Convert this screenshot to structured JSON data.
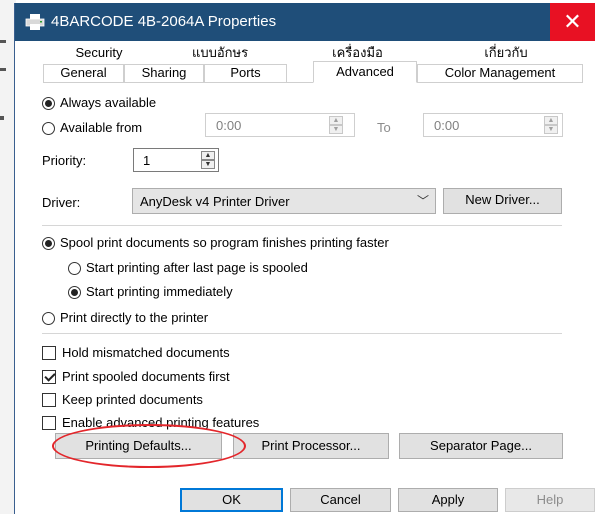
{
  "window": {
    "title": "4BARCODE 4B-2064A Properties",
    "close_glyph": "✕",
    "icon": "printer-icon"
  },
  "tabs": {
    "row1": [
      "Security",
      "แบบอักษร",
      "เครื่องมือ",
      "เกี่ยวกับ"
    ],
    "row2": [
      "General",
      "Sharing",
      "Ports",
      "Advanced",
      "Color Management"
    ],
    "active": "Advanced"
  },
  "availability": {
    "always_label": "Always available",
    "from_label": "Available from",
    "from_time": "0:00",
    "to_label": "To",
    "to_time": "0:00",
    "selected": "always"
  },
  "priority": {
    "label": "Priority:",
    "value": "1"
  },
  "driver": {
    "label": "Driver:",
    "value": "AnyDesk v4 Printer Driver",
    "new_driver_button": "New Driver..."
  },
  "spooling": {
    "spool_label": "Spool print documents so program finishes printing faster",
    "after_last_page_label": "Start printing after last page is spooled",
    "immediately_label": "Start printing immediately",
    "direct_label": "Print directly to the printer",
    "selected_mode": "spool",
    "selected_spool_option": "immediately"
  },
  "options": {
    "hold_mismatched": {
      "label": "Hold mismatched documents",
      "checked": false
    },
    "print_spooled_first": {
      "label": "Print spooled documents first",
      "checked": true
    },
    "keep_printed": {
      "label": "Keep printed documents",
      "checked": false
    },
    "enable_advanced": {
      "label": "Enable advanced printing features",
      "checked": false
    }
  },
  "buttons": {
    "printing_defaults": "Printing Defaults...",
    "print_processor": "Print Processor...",
    "separator_page": "Separator Page...",
    "ok": "OK",
    "cancel": "Cancel",
    "apply": "Apply",
    "help": "Help"
  },
  "colors": {
    "titlebar": "#1f4e79",
    "close": "#e81123",
    "highlight": "#e3262b",
    "focus": "#0078d7"
  }
}
